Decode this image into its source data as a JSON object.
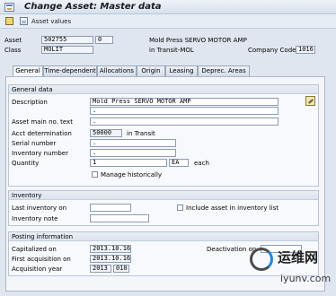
{
  "window": {
    "title": "Change Asset:  Master data"
  },
  "toolbar": {
    "asset_values_label": "Asset values"
  },
  "header": {
    "asset_label": "Asset",
    "asset_number": "502755",
    "asset_sub": "0",
    "asset_desc": "Mold Press SERVO MOTOR AMP",
    "class_label": "Class",
    "class_value": "MOLIT",
    "class_desc": "in Transit-MOL",
    "company_code_label": "Company Code",
    "company_code_value": "1016"
  },
  "tabs": [
    {
      "label": "General"
    },
    {
      "label": "Time-dependent"
    },
    {
      "label": "Allocations"
    },
    {
      "label": "Origin"
    },
    {
      "label": "Leasing"
    },
    {
      "label": "Deprec. Areas"
    }
  ],
  "general_data": {
    "title": "General data",
    "description_label": "Description",
    "description_value": "Mold Press SERVO MOTOR AMP",
    "description2_value": ".",
    "main_asset_text_label": "Asset main no. text",
    "main_asset_text_value": ".",
    "acct_det_label": "Acct determination",
    "acct_det_value": "50000",
    "acct_det_desc": "in Transit",
    "serial_label": "Serial number",
    "serial_value": ".",
    "inventory_number_label": "Inventory number",
    "inventory_number_value": ".",
    "quantity_label": "Quantity",
    "quantity_value": "1",
    "unit_value": "EA",
    "unit_desc": "each",
    "manage_hist_label": "Manage historically"
  },
  "inventory": {
    "title": "Inventory",
    "last_inventory_label": "Last inventory on",
    "last_inventory_value": "",
    "include_label": "Include asset in inventory list",
    "inventory_note_label": "Inventory note",
    "inventory_note_value": ""
  },
  "posting": {
    "title": "Posting information",
    "capitalized_label": "Capitalized on",
    "capitalized_value": "2013.10.16",
    "deactivation_label": "Deactivation on",
    "deactivation_value": "",
    "first_acq_label": "First acquisition on",
    "first_acq_value": "2013.10.16",
    "acq_year_label": "Acquisition year",
    "acq_year_value": "2013",
    "acq_period_value": "010"
  },
  "watermark": {
    "cn_text": "运维网",
    "url_text": "iyunv.com"
  }
}
